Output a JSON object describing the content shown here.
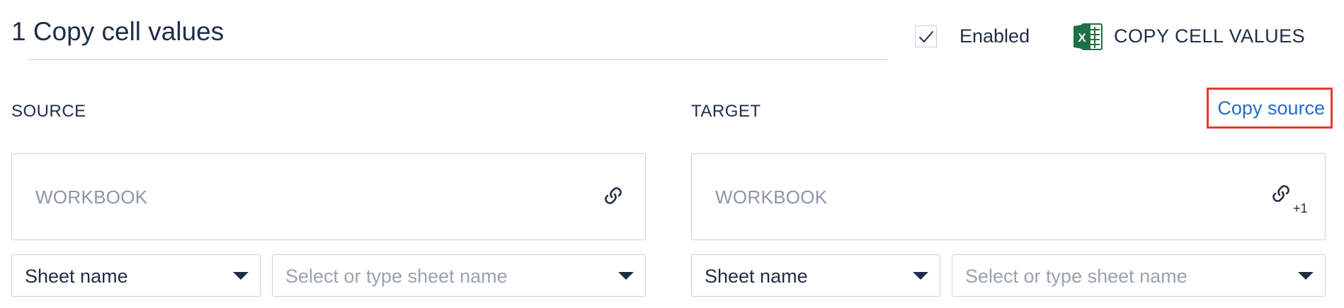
{
  "step": {
    "title": "1 Copy cell values",
    "enabled_label": "Enabled",
    "enabled_checked": true,
    "action_type": "COPY CELL VALUES",
    "action_icon": "excel-icon",
    "excel_icon_letter": "X"
  },
  "source": {
    "header": "SOURCE",
    "workbook_placeholder": "WORKBOOK",
    "link_icon": "link-icon",
    "sheet_mode": "Sheet name",
    "sheet_placeholder": "Select or type sheet name"
  },
  "target": {
    "header": "TARGET",
    "copy_source_label": "Copy source",
    "workbook_placeholder": "WORKBOOK",
    "link_icon": "link-icon",
    "link_count": "+1",
    "sheet_mode": "Sheet name",
    "sheet_placeholder": "Select or type sheet name"
  },
  "colors": {
    "text_dark": "#1e2e48",
    "placeholder": "#8d97a5",
    "border": "#c9ced6",
    "link": "#1f6fc5",
    "highlight": "#e53b2e",
    "excel_green": "#1e7145"
  }
}
